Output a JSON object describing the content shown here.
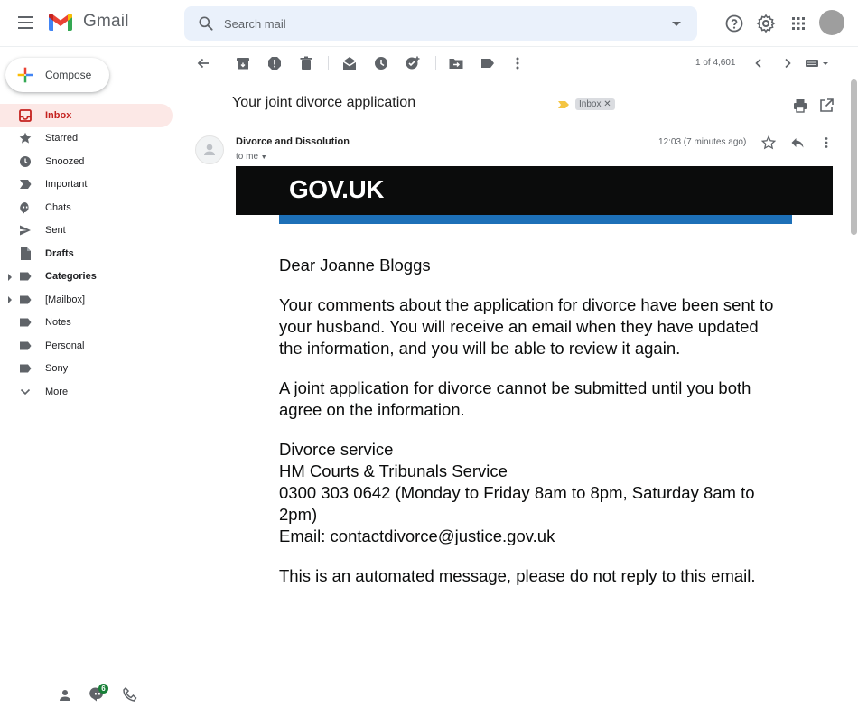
{
  "header": {
    "app_name": "Gmail",
    "search": {
      "placeholder": "Search mail"
    },
    "icons": [
      "menu-icon",
      "help-icon",
      "settings-icon",
      "apps-icon",
      "account-avatar"
    ]
  },
  "sidebar": {
    "compose_label": "Compose",
    "items": [
      {
        "label": "Inbox",
        "icon": "inbox-icon"
      },
      {
        "label": "Starred",
        "icon": "star-icon"
      },
      {
        "label": "Snoozed",
        "icon": "clock-icon"
      },
      {
        "label": "Important",
        "icon": "important-icon"
      },
      {
        "label": "Chats",
        "icon": "chat-icon"
      },
      {
        "label": "Sent",
        "icon": "send-icon"
      },
      {
        "label": "Drafts",
        "icon": "draft-icon"
      },
      {
        "label": "Categories",
        "icon": "label-icon"
      },
      {
        "label": "[Mailbox]",
        "icon": "label-icon"
      },
      {
        "label": "Notes",
        "icon": "label-icon"
      },
      {
        "label": "Personal",
        "icon": "label-icon"
      },
      {
        "label": "Sony",
        "icon": "label-icon"
      },
      {
        "label": "More",
        "icon": "chevron-down-icon"
      }
    ],
    "chat_badge_count": "6"
  },
  "toolbar": {
    "pager_text": "1 of 4,601"
  },
  "message": {
    "subject": "Your joint divorce application",
    "label": "Inbox",
    "sender": "Divorce and Dissolution",
    "to": "to me",
    "timestamp": "12:03 (7 minutes ago)",
    "banner": "GOV.UK",
    "greeting": "Dear Joanne Bloggs",
    "para1": "Your comments about the application for divorce have been sent to your husband. You will receive an email when they have updated the information, and you will be able to review it again.",
    "para2": "A joint application for divorce cannot be submitted until you both agree on the information.",
    "sig_service": "Divorce service",
    "sig_org": "HM Courts & Tribunals Service",
    "sig_phone": "0300 303 0642 (Monday to Friday 8am to 8pm, Saturday 8am to 2pm)",
    "sig_email": "Email: contactdivorce@justice.gov.uk",
    "footer": "This is an automated message, please do not reply to this email."
  },
  "colors": {
    "inbox_active_bg": "#fce8e6",
    "inbox_active_text": "#c5221f",
    "gov_black": "#0b0c0c",
    "gov_blue": "#1d70b8"
  }
}
